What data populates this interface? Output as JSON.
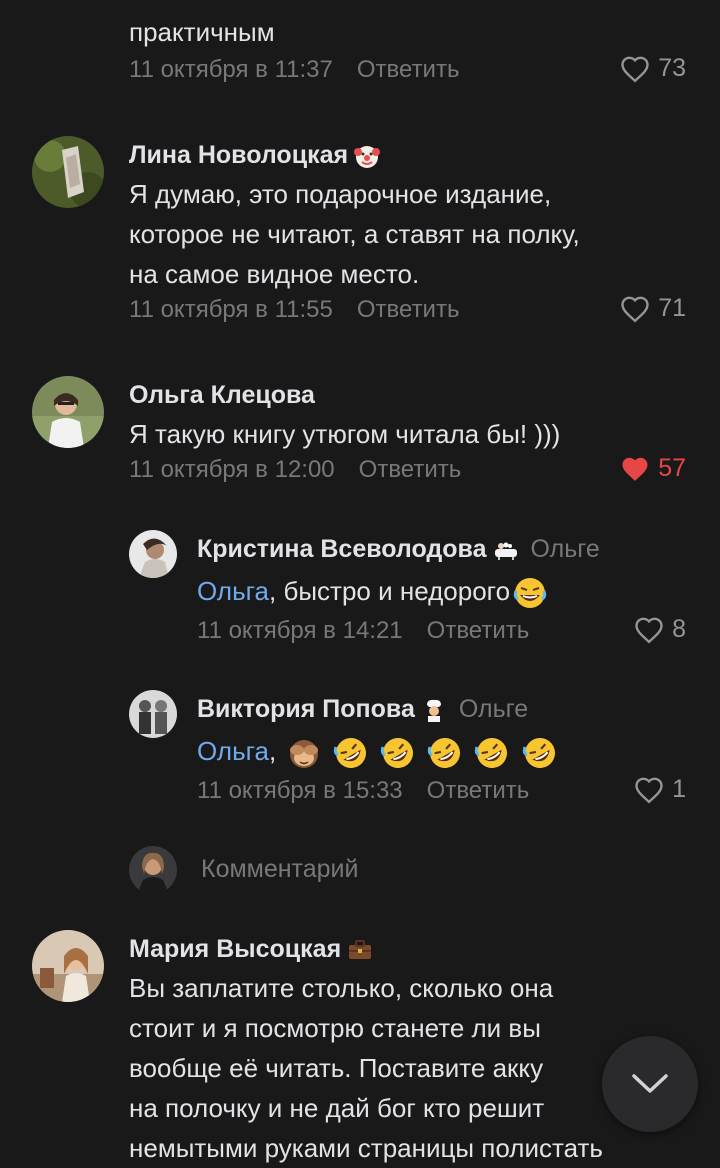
{
  "comments": [
    {
      "text_tail": "практичным",
      "date": "11 октября в 11:37",
      "reply_label": "Ответить",
      "likes": "73"
    },
    {
      "author": "Лина Новолоцкая",
      "lines": [
        "Я думаю, это подарочное издание,",
        "которое не читают, а ставят на полку,",
        "на самое видное место."
      ],
      "date": "11 октября в 11:55",
      "reply_label": "Ответить",
      "likes": "71"
    },
    {
      "author": "Ольга Клецова",
      "lines": [
        "Я такую книгу утюгом читала бы! )))"
      ],
      "date": "11 октября в 12:00",
      "reply_label": "Ответить",
      "likes": "57",
      "liked": true
    }
  ],
  "replies": [
    {
      "author": "Кристина Всеволодова",
      "reply_to": "Ольге",
      "mention": "Ольга",
      "text": ", быстро и недорого",
      "date": "11 октября в 14:21",
      "reply_label": "Ответить",
      "likes": "8"
    },
    {
      "author": "Виктория Попова",
      "reply_to": "Ольге",
      "mention": "Ольга",
      "text": ",",
      "date": "11 октября в 15:33",
      "reply_label": "Ответить",
      "likes": "1"
    }
  ],
  "composer": {
    "placeholder": "Комментарий"
  },
  "last_comment": {
    "author": "Мария Высоцкая",
    "lines": [
      "Вы заплатите столько, сколько она",
      "стоит и я посмотрю станете ли вы",
      "вообще её читать. Поставите акку",
      "на полочку и не дай бог кто решит",
      "немытыми руками страницы полистать"
    ]
  },
  "colors": {
    "background": "#19191a",
    "accent": "#71aaeb",
    "liked": "#e64646",
    "secondary": "#76787a"
  },
  "icons": [
    "heart-icon",
    "heart-filled-icon",
    "clown-emoji",
    "bathtub-emoji",
    "chef-emoji",
    "laughing-emoji",
    "see-no-evil-emoji",
    "rofl-emoji",
    "briefcase-emoji",
    "chevron-down-icon"
  ]
}
